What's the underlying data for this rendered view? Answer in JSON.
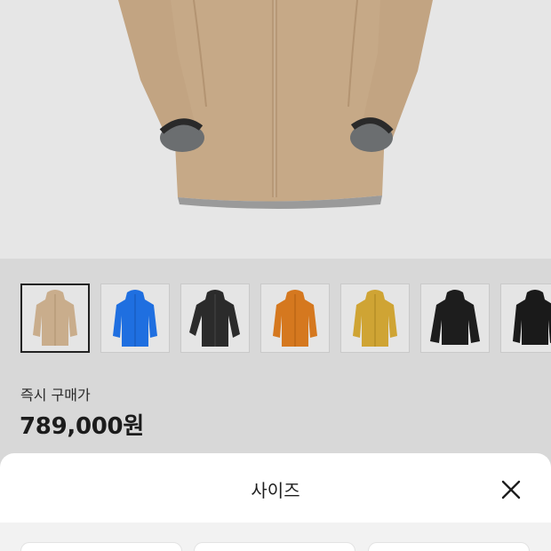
{
  "product": {
    "main_image": "beige-hooded-jacket",
    "thumbnails": [
      {
        "color": "#c9ad8c",
        "name": "beige-jacket",
        "selected": true
      },
      {
        "color": "#1f6fe0",
        "name": "blue-jacket",
        "selected": false
      },
      {
        "color": "#2b2b2b",
        "name": "black-accent-jacket",
        "selected": false
      },
      {
        "color": "#d5781f",
        "name": "orange-jacket",
        "selected": false
      },
      {
        "color": "#cfa434",
        "name": "mustard-jacket",
        "selected": false
      },
      {
        "color": "#1d1d1d",
        "name": "black-jacket",
        "selected": false
      },
      {
        "color": "#1a1a1a",
        "name": "black-jacket-2",
        "selected": false
      }
    ]
  },
  "price": {
    "label": "즉시 구매가",
    "value": "789,000원"
  },
  "sheet": {
    "title": "사이즈",
    "close_icon": "close-icon"
  },
  "colors": {
    "jacket_main": "#c7aa88",
    "sheet_bg": "#ffffff",
    "page_bg": "#d8d8d8"
  }
}
